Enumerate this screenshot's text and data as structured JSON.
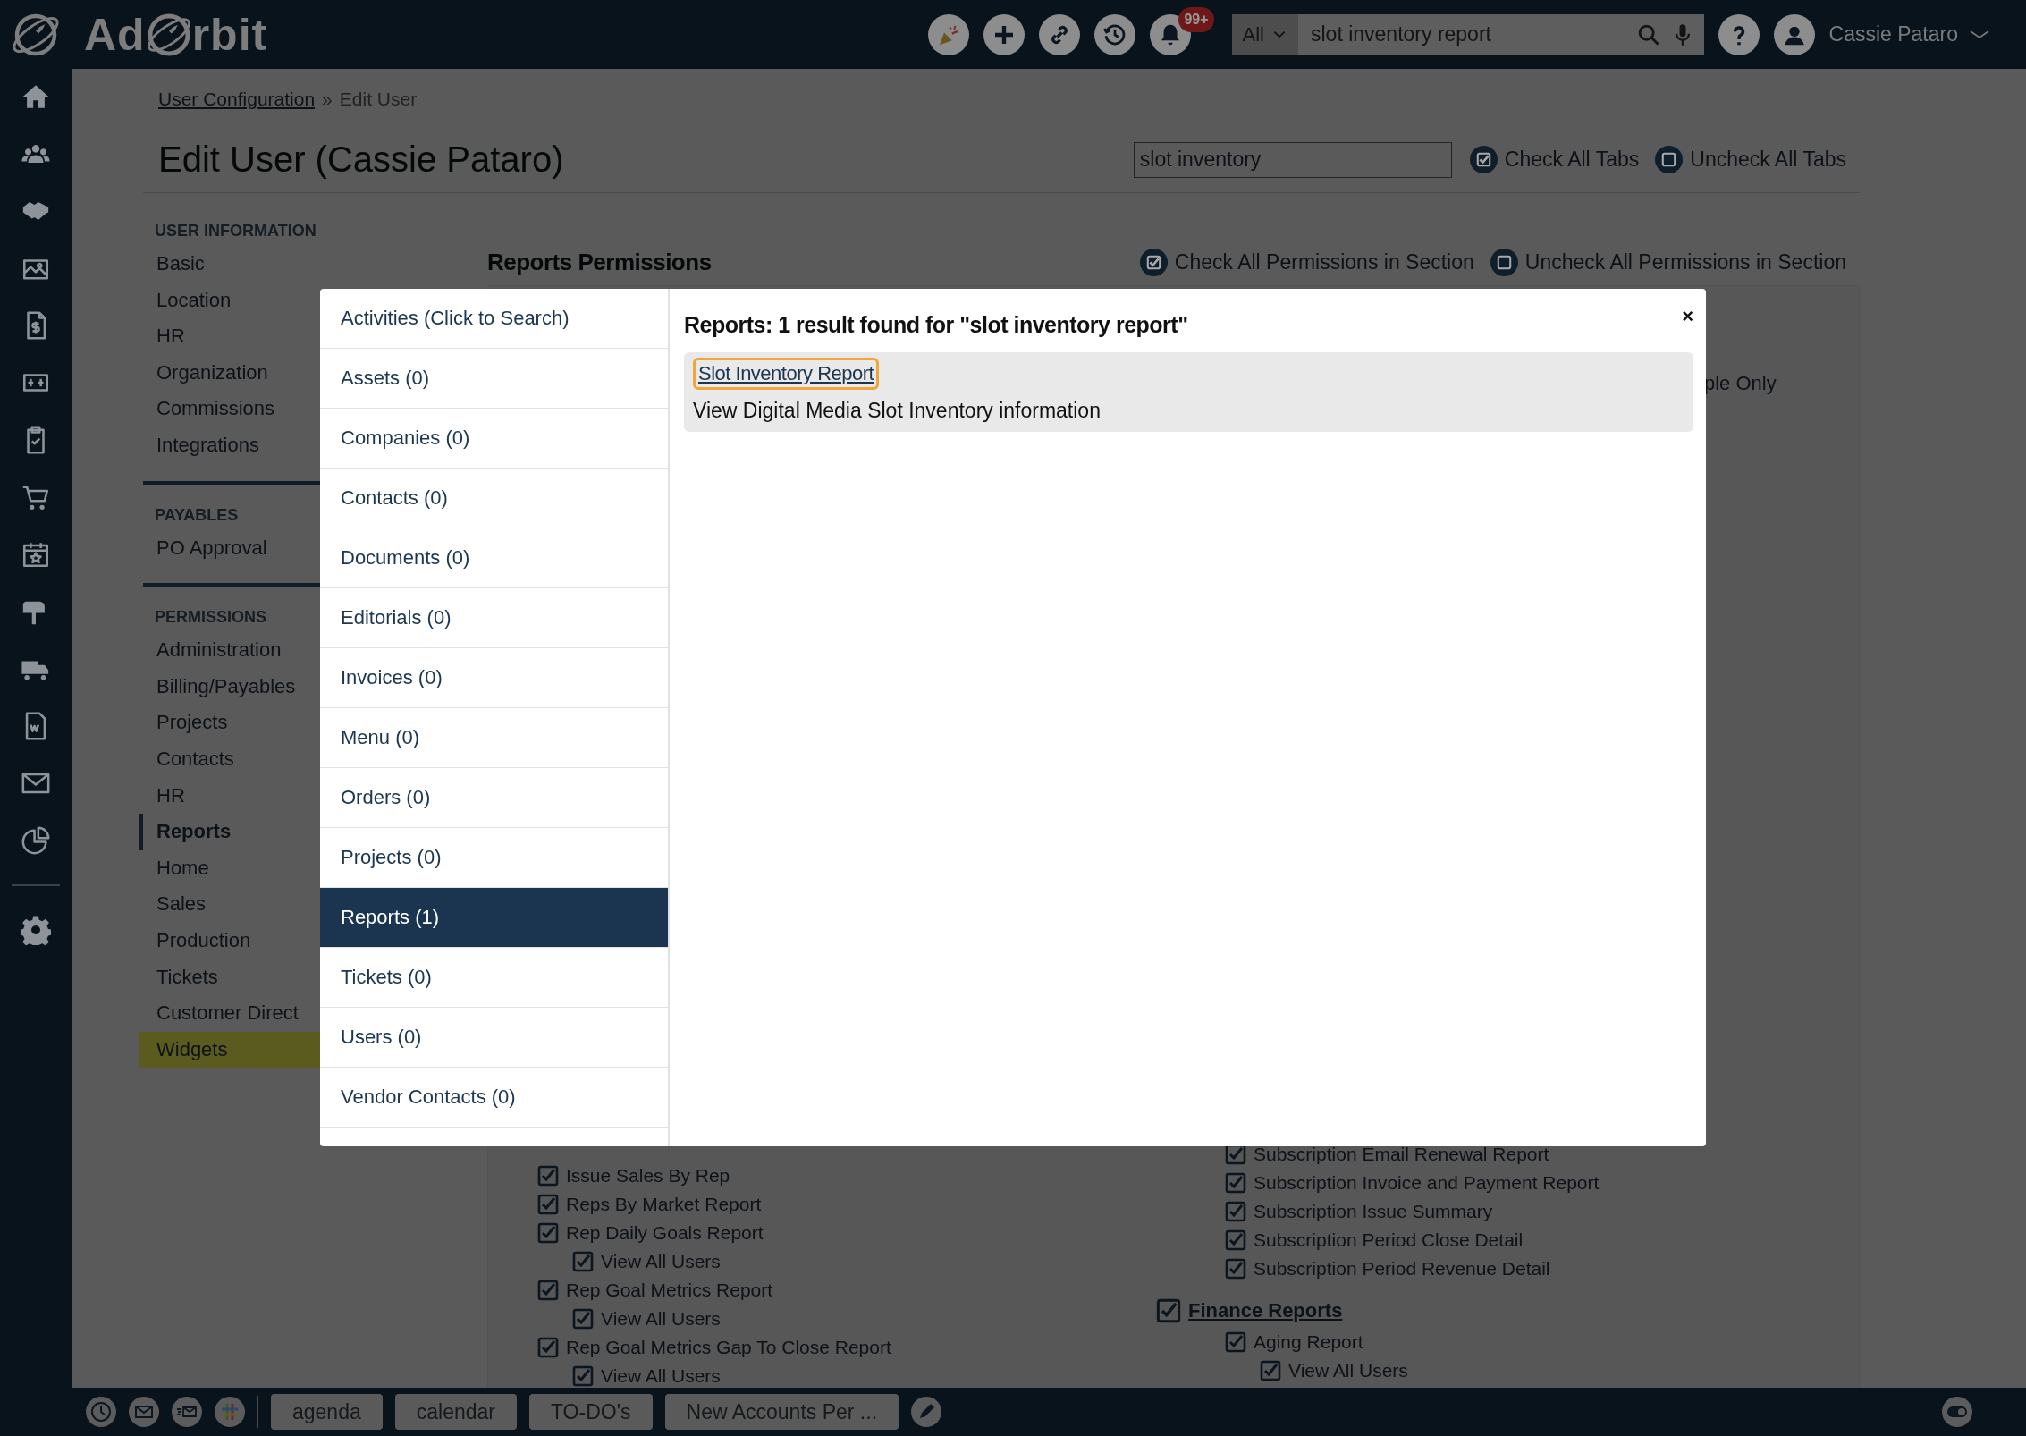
{
  "logo": {
    "before": "Ad",
    "after": "rbit"
  },
  "top_bar": {
    "notifications_badge": "99+",
    "search": {
      "scope": "All",
      "value": "slot inventory report"
    },
    "user_name": "Cassie Pataro"
  },
  "breadcrumb": {
    "link": "User Configuration",
    "separator": "»",
    "current": "Edit User"
  },
  "page_title": "Edit User (Cassie Pataro)",
  "filter": {
    "value": "slot inventory"
  },
  "tab_actions": [
    {
      "label": "Check All Tabs",
      "checked": true
    },
    {
      "label": "Uncheck All Tabs",
      "checked": false
    }
  ],
  "nav_sections": [
    {
      "heading": "USER INFORMATION",
      "items": [
        {
          "label": "Basic",
          "selected": false,
          "highlighted": false
        },
        {
          "label": "Location",
          "selected": false,
          "highlighted": false
        },
        {
          "label": "HR",
          "selected": false,
          "highlighted": false
        },
        {
          "label": "Organization",
          "selected": false,
          "highlighted": false
        },
        {
          "label": "Commissions",
          "selected": false,
          "highlighted": false
        },
        {
          "label": "Integrations",
          "selected": false,
          "highlighted": false
        }
      ]
    },
    {
      "heading": "PAYABLES",
      "items": [
        {
          "label": "PO Approval",
          "selected": false,
          "highlighted": false
        }
      ]
    },
    {
      "heading": "PERMISSIONS",
      "items": [
        {
          "label": "Administration",
          "selected": false,
          "highlighted": false
        },
        {
          "label": "Billing/Payables",
          "selected": false,
          "highlighted": false
        },
        {
          "label": "Projects",
          "selected": false,
          "highlighted": false
        },
        {
          "label": "Contacts",
          "selected": false,
          "highlighted": false
        },
        {
          "label": "HR",
          "selected": false,
          "highlighted": false
        },
        {
          "label": "Reports",
          "selected": true,
          "highlighted": false
        },
        {
          "label": "Home",
          "selected": false,
          "highlighted": false
        },
        {
          "label": "Sales",
          "selected": false,
          "highlighted": false
        },
        {
          "label": "Production",
          "selected": false,
          "highlighted": false
        },
        {
          "label": "Tickets",
          "selected": false,
          "highlighted": false
        },
        {
          "label": "Customer Direct",
          "selected": false,
          "highlighted": false
        },
        {
          "label": "Widgets",
          "selected": false,
          "highlighted": true
        }
      ]
    }
  ],
  "section": {
    "title": "Reports Permissions",
    "actions": [
      {
        "label": "Check All Permissions in Section",
        "checked": true
      },
      {
        "label": "Uncheck All Permissions in Section",
        "checked": false
      }
    ],
    "partial_text": "ple Only",
    "left_permissions": [
      {
        "kind": "permission",
        "label": "Issue Sales By Rep",
        "checked": true
      },
      {
        "kind": "permission",
        "label": "Reps By Market Report",
        "checked": true
      },
      {
        "kind": "permission",
        "label": "Rep Daily Goals Report",
        "checked": true,
        "children": [
          {
            "label": "View All Users",
            "checked": true
          }
        ]
      },
      {
        "kind": "permission",
        "label": "Rep Goal Metrics Report",
        "checked": true,
        "children": [
          {
            "label": "View All Users",
            "checked": true
          }
        ]
      },
      {
        "kind": "permission",
        "label": "Rep Goal Metrics Gap To Close Report",
        "checked": true,
        "children": [
          {
            "label": "View All Users",
            "checked": true
          }
        ]
      }
    ],
    "right_permissions": [
      {
        "children": [
          {
            "label": "Subscription Email Renewal Report",
            "checked": true
          },
          {
            "label": "Subscription Invoice and Payment Report",
            "checked": true
          },
          {
            "label": "Subscription Issue Summary",
            "checked": true
          },
          {
            "label": "Subscription Period Close Detail",
            "checked": true
          },
          {
            "label": "Subscription Period Revenue Detail",
            "checked": true
          }
        ]
      },
      {
        "kind": "category",
        "label": "Finance Reports",
        "checked": true,
        "children": [
          {
            "label": "Aging Report",
            "checked": true,
            "children": [
              {
                "label": "View All Users",
                "checked": true
              }
            ]
          }
        ]
      }
    ]
  },
  "modal": {
    "close": "×",
    "results_title": "Reports: 1 result found for \"slot inventory report\"",
    "categories": [
      {
        "label": "Activities (Click to Search)",
        "selected": false
      },
      {
        "label": "Assets (0)",
        "selected": false
      },
      {
        "label": "Companies (0)",
        "selected": false
      },
      {
        "label": "Contacts (0)",
        "selected": false
      },
      {
        "label": "Documents (0)",
        "selected": false
      },
      {
        "label": "Editorials (0)",
        "selected": false
      },
      {
        "label": "Invoices (0)",
        "selected": false
      },
      {
        "label": "Menu (0)",
        "selected": false
      },
      {
        "label": "Orders (0)",
        "selected": false
      },
      {
        "label": "Projects (0)",
        "selected": false
      },
      {
        "label": "Reports (1)",
        "selected": true
      },
      {
        "label": "Tickets (0)",
        "selected": false
      },
      {
        "label": "Users (0)",
        "selected": false
      },
      {
        "label": "Vendor Contacts (0)",
        "selected": false
      }
    ],
    "results": [
      {
        "title": "Slot Inventory Report",
        "description": "View Digital Media Slot Inventory information",
        "focused": true
      }
    ]
  },
  "quick_tabs": [
    "agenda",
    "calendar",
    "TO-DO's",
    "New Accounts Per ..."
  ]
}
